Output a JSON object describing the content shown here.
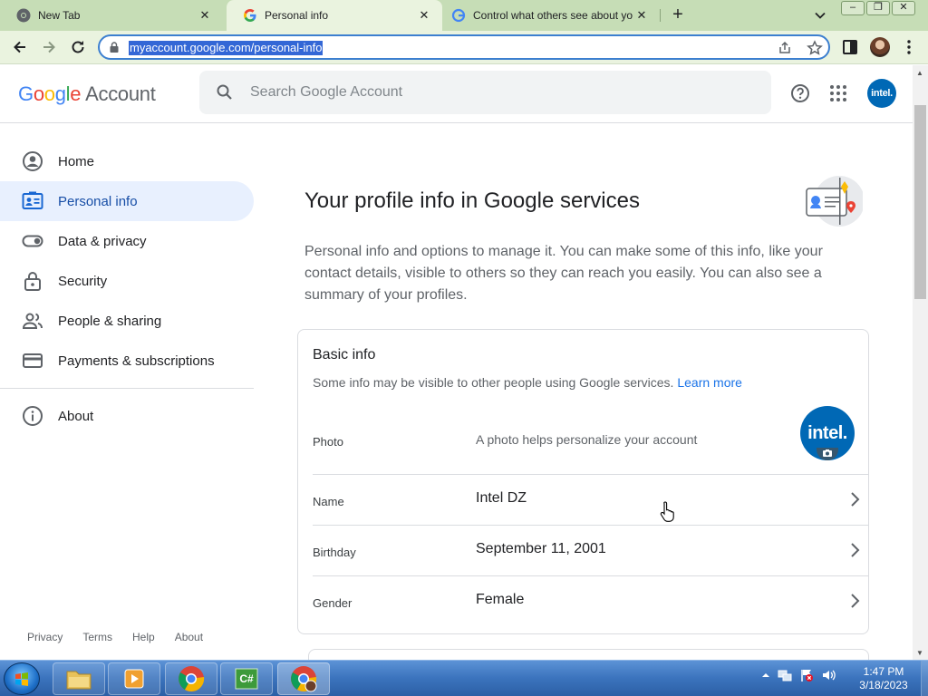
{
  "browser": {
    "tabs": [
      {
        "title": "New Tab",
        "icon": "chrome-icon",
        "active": false
      },
      {
        "title": "Personal info",
        "icon": "google-g-icon",
        "active": true
      },
      {
        "title": "Control what others see about yo",
        "icon": "google-g-icon",
        "active": false
      }
    ],
    "close_glyph": "✕",
    "new_tab_glyph": "+",
    "window_controls": {
      "minimize": "–",
      "restore": "❐",
      "close": "✕"
    },
    "url": "myaccount.google.com/personal-info"
  },
  "header": {
    "logo": {
      "g1": "G",
      "o1": "o",
      "o2": "o",
      "g2": "g",
      "l": "l",
      "e": "e",
      "account": "Account"
    },
    "search_placeholder": "Search Google Account",
    "avatar_text": "intel."
  },
  "sidebar": {
    "items": [
      {
        "label": "Home",
        "icon": "account-circle-icon",
        "active": false
      },
      {
        "label": "Personal info",
        "icon": "id-card-icon",
        "active": true
      },
      {
        "label": "Data & privacy",
        "icon": "toggle-icon",
        "active": false
      },
      {
        "label": "Security",
        "icon": "lock-icon",
        "active": false
      },
      {
        "label": "People & sharing",
        "icon": "people-icon",
        "active": false
      },
      {
        "label": "Payments & subscriptions",
        "icon": "credit-card-icon",
        "active": false
      }
    ],
    "about": {
      "label": "About",
      "icon": "info-icon"
    },
    "footer": [
      "Privacy",
      "Terms",
      "Help",
      "About"
    ]
  },
  "main": {
    "title": "Your profile info in Google services",
    "description": "Personal info and options to manage it. You can make some of this info, like your contact details, visible to others so they can reach you easily. You can also see a summary of your profiles.",
    "basic_info": {
      "title": "Basic info",
      "subtitle": "Some info may be visible to other people using Google services.",
      "learn_more": "Learn more",
      "photo": {
        "label": "Photo",
        "hint": "A photo helps personalize your account",
        "avatar_text": "intel."
      },
      "name": {
        "label": "Name",
        "value": "Intel DZ"
      },
      "birthday": {
        "label": "Birthday",
        "value": "September 11, 2001"
      },
      "gender": {
        "label": "Gender",
        "value": "Female"
      }
    }
  },
  "taskbar": {
    "time": "1:47 PM",
    "date": "3/18/2023",
    "apps": [
      "file-explorer-icon",
      "media-player-icon",
      "chrome-icon",
      "csharp-icon",
      "chrome-profile-icon"
    ]
  }
}
